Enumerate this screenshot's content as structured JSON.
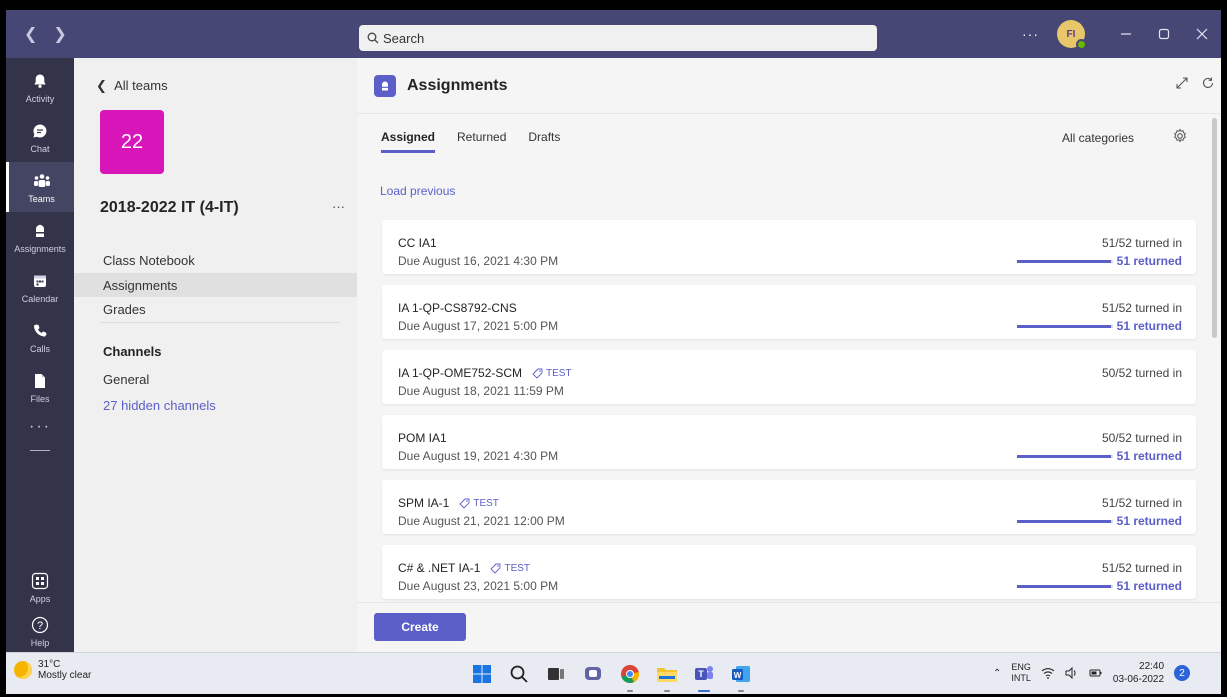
{
  "titlebar": {
    "search_placeholder": "Search",
    "more": "···",
    "avatar_initials": "FI"
  },
  "appbar": {
    "items": [
      {
        "label": "Activity",
        "icon": "bell-icon"
      },
      {
        "label": "Chat",
        "icon": "chat-icon"
      },
      {
        "label": "Teams",
        "icon": "teams-icon"
      },
      {
        "label": "Assignments",
        "icon": "assignments-icon"
      },
      {
        "label": "Calendar",
        "icon": "calendar-icon"
      },
      {
        "label": "Calls",
        "icon": "phone-icon"
      },
      {
        "label": "Files",
        "icon": "file-icon"
      }
    ],
    "more": "···",
    "apps_label": "Apps",
    "help_label": "Help"
  },
  "leftpanel": {
    "back_label": "All teams",
    "team_tile": "22",
    "team_name": "2018-2022 IT (4-IT)",
    "team_more": "···",
    "items": [
      "Class Notebook",
      "Assignments",
      "Grades"
    ],
    "channels_heading": "Channels",
    "general": "General",
    "hidden_channels": "27 hidden channels"
  },
  "main": {
    "title": "Assignments",
    "tabs": [
      "Assigned",
      "Returned",
      "Drafts"
    ],
    "all_categories": "All categories",
    "load_previous": "Load previous",
    "create_label": "Create",
    "assignments": [
      {
        "title": "CC IA1",
        "tag": "",
        "due": "Due August 16, 2021 4:30 PM",
        "turned_in": "51/52 turned in",
        "returned": "51 returned",
        "returned_fraction": 0.98
      },
      {
        "title": "IA 1-QP-CS8792-CNS",
        "tag": "",
        "due": "Due August 17, 2021 5:00 PM",
        "turned_in": "51/52 turned in",
        "returned": "51 returned",
        "returned_fraction": 0.98
      },
      {
        "title": "IA 1-QP-OME752-SCM",
        "tag": "TEST",
        "due": "Due August 18, 2021 11:59 PM",
        "turned_in": "50/52 turned in",
        "returned": "",
        "returned_fraction": 0
      },
      {
        "title": "POM IA1",
        "tag": "",
        "due": "Due August 19, 2021 4:30 PM",
        "turned_in": "50/52 turned in",
        "returned": "51 returned",
        "returned_fraction": 0.98
      },
      {
        "title": "SPM IA-1",
        "tag": "TEST",
        "due": "Due August 21, 2021 12:00 PM",
        "turned_in": "51/52 turned in",
        "returned": "51 returned",
        "returned_fraction": 0.98
      },
      {
        "title": "C# & .NET IA-1",
        "tag": "TEST",
        "due": "Due August 23, 2021 5:00 PM",
        "turned_in": "51/52 turned in",
        "returned": "51 returned",
        "returned_fraction": 0.98
      }
    ]
  },
  "taskbar": {
    "temperature": "31°C",
    "weather": "Mostly clear",
    "lang_top": "ENG",
    "lang_bottom": "INTL",
    "time": "22:40",
    "date": "03-06-2022",
    "notifications": "2"
  },
  "colors": {
    "titlebar": "#464775",
    "appbar": "#33344a",
    "accent": "#5b5fc7",
    "team_tile": "#d815b8"
  }
}
